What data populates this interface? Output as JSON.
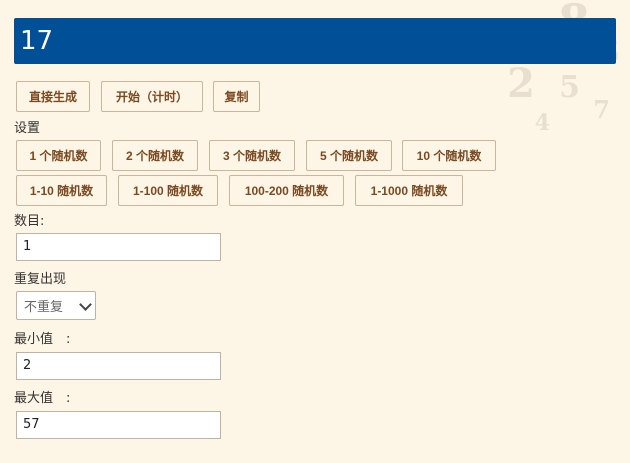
{
  "result": {
    "value": "17"
  },
  "actions": {
    "direct": "直接生成",
    "timer": "开始（计时）",
    "copy": "复制"
  },
  "settings": {
    "title": "设置",
    "presets_count": [
      "1 个随机数",
      "2 个随机数",
      "3 个随机数",
      "5 个随机数",
      "10 个随机数"
    ],
    "presets_range": [
      "1-10 随机数",
      "1-100 随机数",
      "100-200 随机数",
      "1-1000 随机数"
    ]
  },
  "form": {
    "count_label": "数目:",
    "count_value": "1",
    "repeat_label": "重复出现",
    "repeat_selected": "不重复",
    "min_label": "最小值　:",
    "min_value": "2",
    "max_label": "最大值　:",
    "max_value": "57"
  }
}
